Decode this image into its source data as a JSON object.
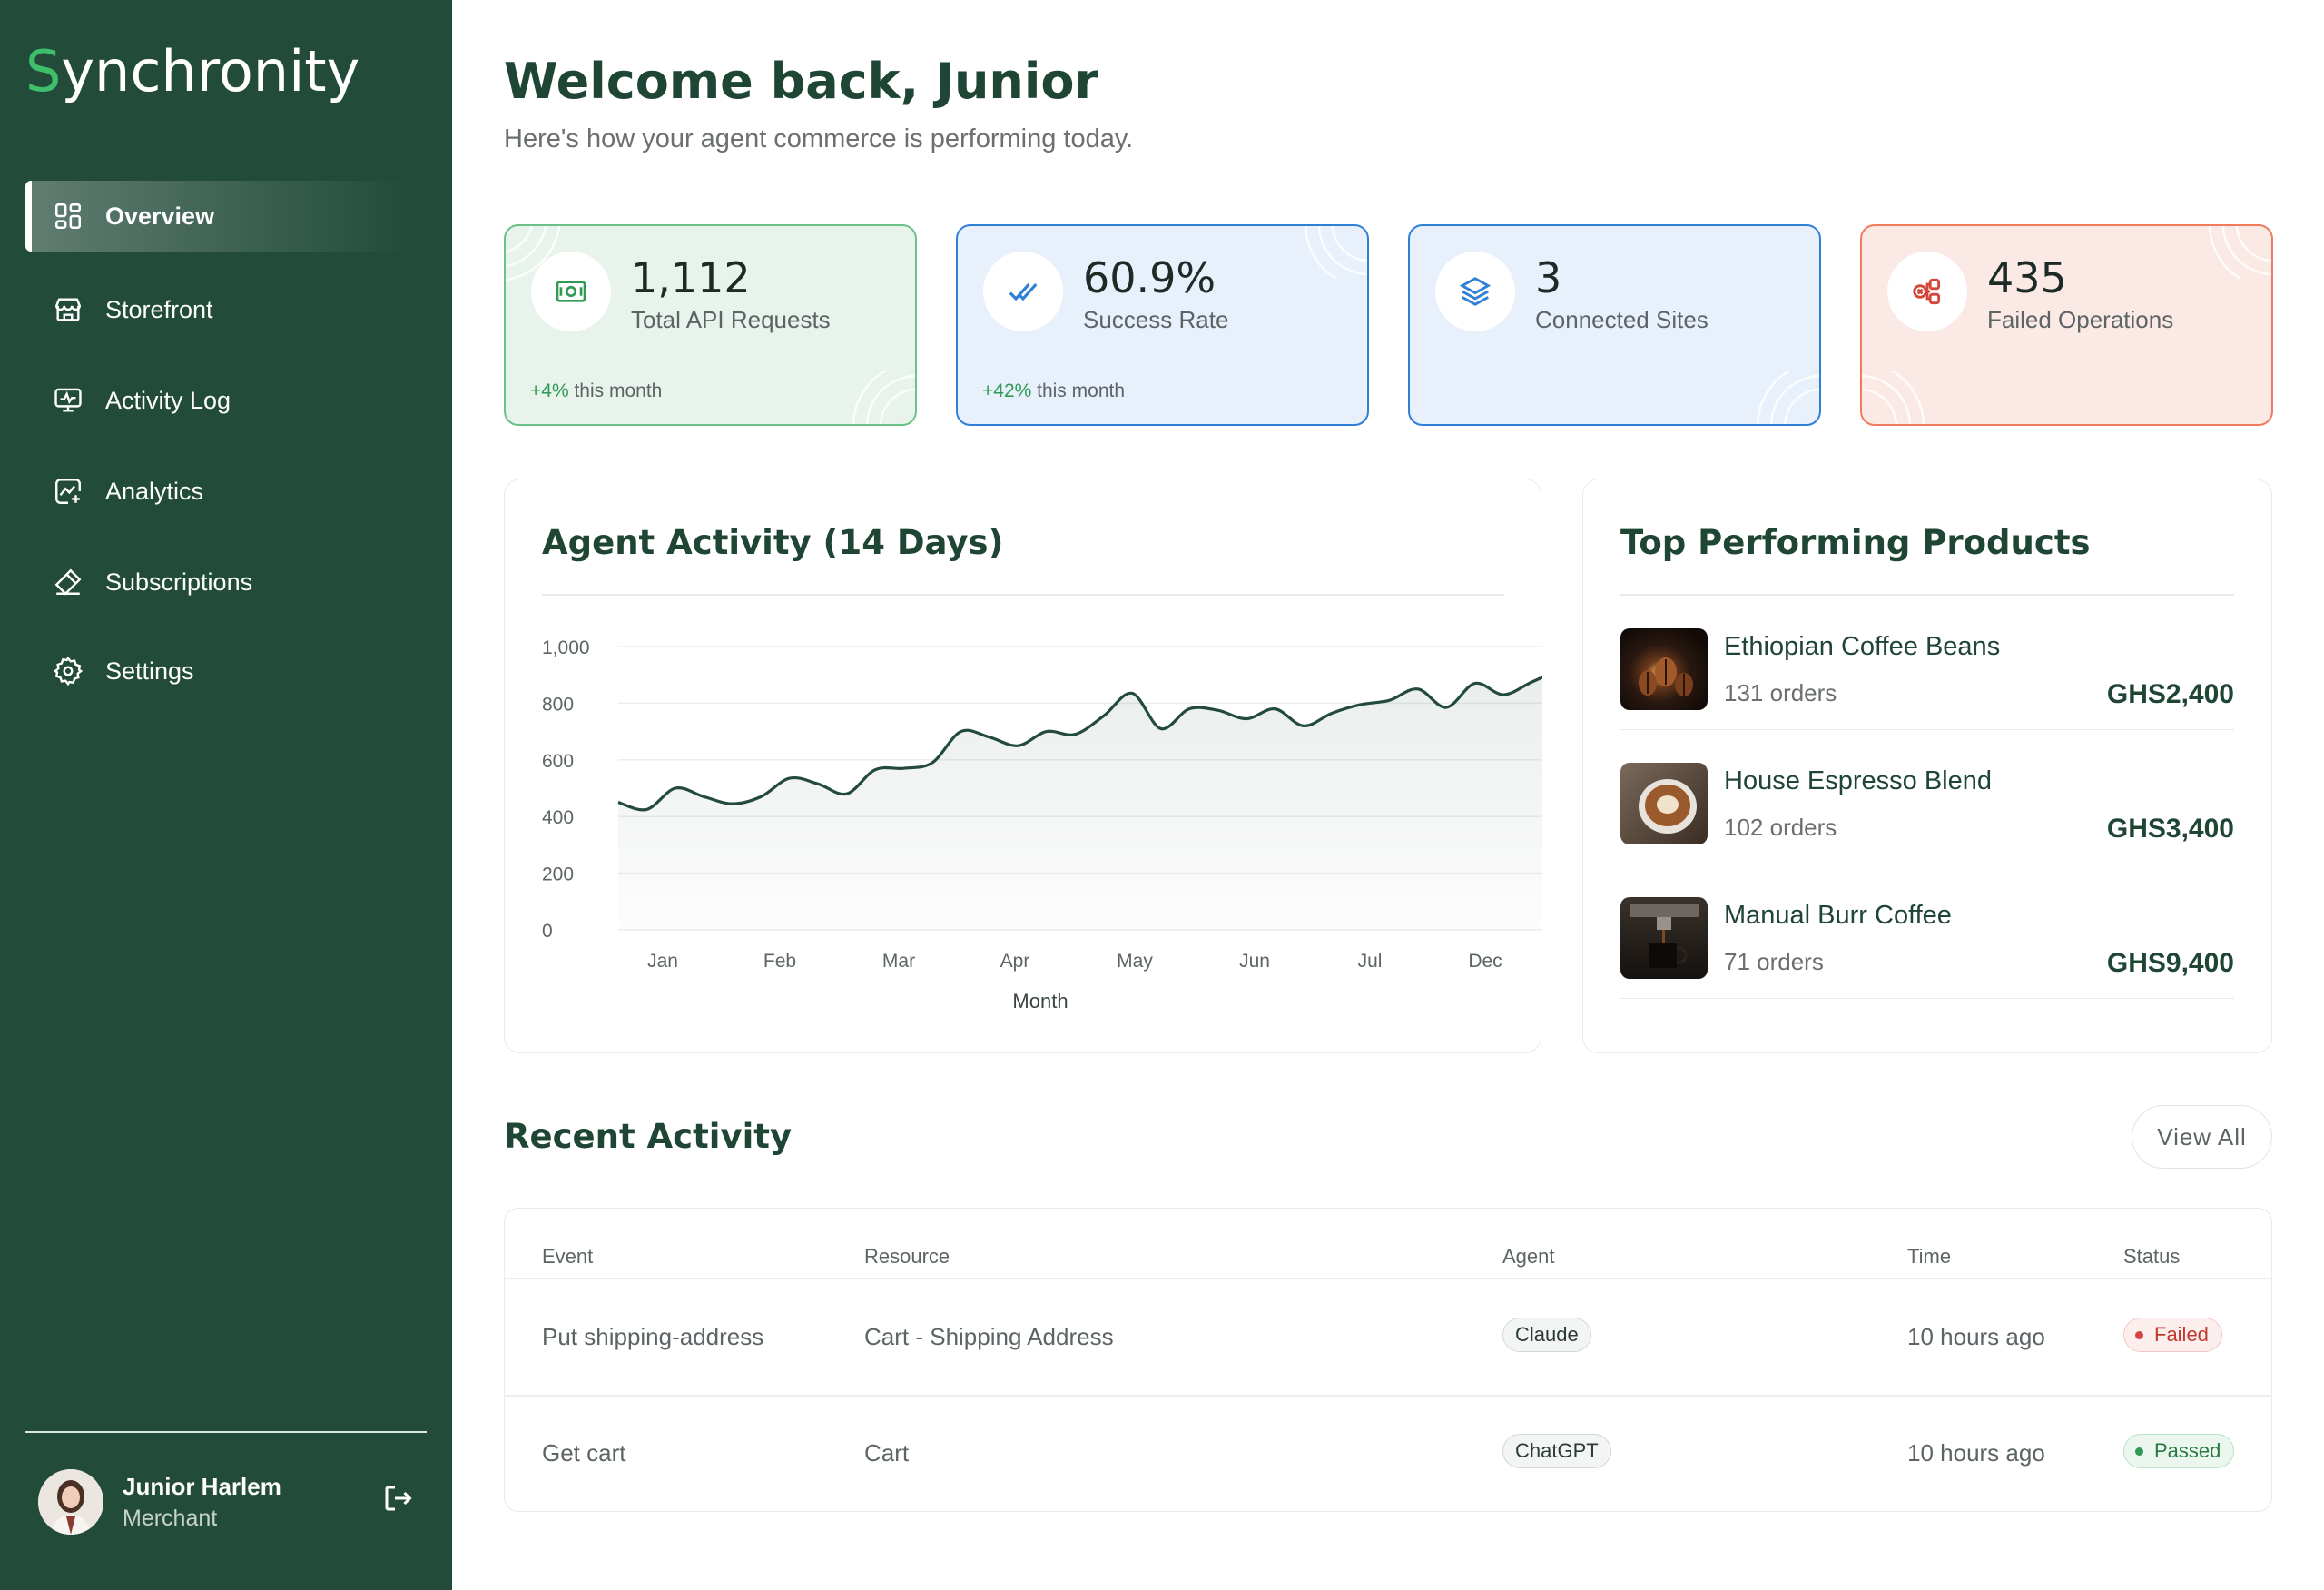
{
  "app": {
    "logo_first": "S",
    "logo_rest": "ynchronity"
  },
  "sidebar": {
    "items": [
      {
        "label": "Overview",
        "icon": "grid-icon",
        "active": true
      },
      {
        "label": "Storefront",
        "icon": "storefront-icon"
      },
      {
        "label": "Activity Log",
        "icon": "monitor-activity-icon"
      },
      {
        "label": "Analytics",
        "icon": "analytics-icon"
      },
      {
        "label": "Subscriptions",
        "icon": "ticket-icon"
      },
      {
        "label": "Settings",
        "icon": "gear-icon"
      }
    ],
    "user": {
      "name": "Junior Harlem",
      "role": "Merchant"
    }
  },
  "header": {
    "welcome": "Welcome back, Junior",
    "subtitle": "Here's how your agent commerce is performing today."
  },
  "stats": [
    {
      "value": "1,112",
      "label": "Total API Requests",
      "change": "+4%",
      "change_suffix": " this month",
      "icon": "money-icon",
      "color": "#2e9a53"
    },
    {
      "value": "60.9%",
      "label": "Success Rate",
      "change": "+42%",
      "change_suffix": " this month",
      "icon": "double-check-icon",
      "color": "#2f7fd6"
    },
    {
      "value": "3",
      "label": "Connected Sites",
      "icon": "layers-icon",
      "color": "#2f7fd6"
    },
    {
      "value": "435",
      "label": "Failed Operations",
      "icon": "error-nodes-icon",
      "color": "#d2473a"
    }
  ],
  "activity_chart": {
    "title": "Agent Activity (14 Days)"
  },
  "chart_data": {
    "type": "area",
    "title": "Agent Activity (14 Days)",
    "xlabel": "Month",
    "ylabel": "",
    "x_tick_labels": [
      "Jan",
      "Feb",
      "Mar",
      "Apr",
      "May",
      "Jun",
      "Jul",
      "Dec"
    ],
    "y_tick_labels": [
      "0",
      "200",
      "400",
      "600",
      "800",
      "1,000"
    ],
    "ylim": [
      0,
      1000
    ],
    "grid": true,
    "color": "#224b3a",
    "values": [
      450,
      425,
      500,
      470,
      445,
      470,
      535,
      515,
      480,
      565,
      570,
      590,
      700,
      680,
      650,
      700,
      690,
      755,
      835,
      710,
      780,
      775,
      745,
      780,
      720,
      765,
      795,
      810,
      850,
      785,
      870,
      830,
      875,
      920
    ]
  },
  "top_products": {
    "title": "Top Performing Products",
    "items": [
      {
        "name": "Ethiopian Coffee Beans",
        "orders": "131 orders",
        "price": "GHS2,400"
      },
      {
        "name": "House Espresso Blend",
        "orders": "102 orders",
        "price": "GHS3,400"
      },
      {
        "name": "Manual Burr Coffee",
        "orders": "71 orders",
        "price": "GHS9,400"
      }
    ]
  },
  "recent_activity": {
    "title": "Recent Activity",
    "view_all": "View All",
    "columns": [
      "Event",
      "Resource",
      "Agent",
      "Time",
      "Status"
    ],
    "rows": [
      {
        "event": "Put shipping-address",
        "resource": "Cart - Shipping Address",
        "agent": "Claude",
        "time": "10 hours ago",
        "status": "Failed"
      },
      {
        "event": "Get cart",
        "resource": "Cart",
        "agent": "ChatGPT",
        "time": "10 hours ago",
        "status": "Passed"
      }
    ]
  }
}
